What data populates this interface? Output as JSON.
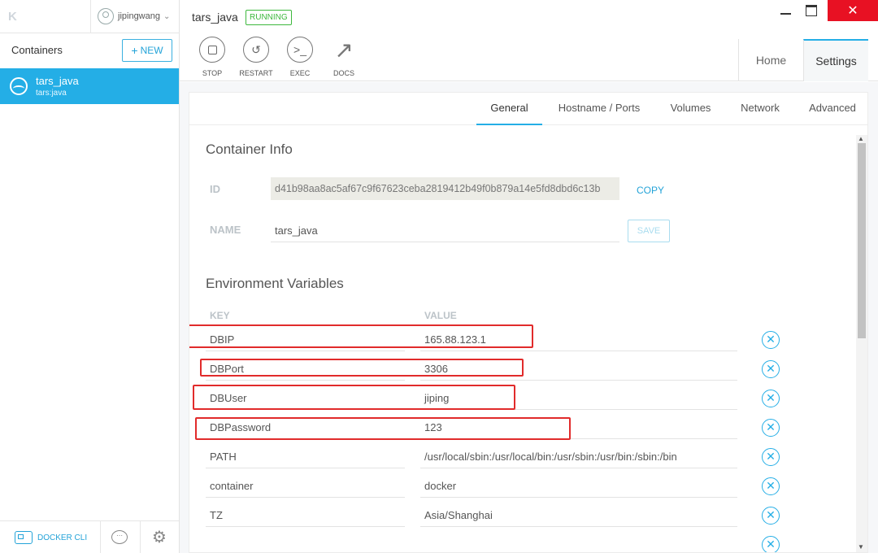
{
  "sidebar": {
    "logo": "K",
    "user": "jipingwang",
    "containers_title": "Containers",
    "new_button": "NEW",
    "items": [
      {
        "name": "tars_java",
        "image": "tars:java"
      }
    ],
    "footer": {
      "docker_cli": "DOCKER CLI"
    }
  },
  "header": {
    "title": "tars_java",
    "status": "RUNNING",
    "toolbar": [
      {
        "label": "STOP",
        "icon": "stop-icon"
      },
      {
        "label": "RESTART",
        "icon": "restart-icon"
      },
      {
        "label": "EXEC",
        "icon": "terminal-icon"
      },
      {
        "label": "DOCS",
        "icon": "external-link-icon"
      }
    ],
    "tabs": [
      "Home",
      "Settings"
    ],
    "active_tab": "Settings"
  },
  "settings": {
    "sub_tabs": [
      "General",
      "Hostname / Ports",
      "Volumes",
      "Network",
      "Advanced"
    ],
    "active_sub_tab": "General",
    "container_info": {
      "title": "Container Info",
      "id_label": "ID",
      "id_value": "d41b98aa8ac5af67c9f67623ceba2819412b49f0b879a14e5fd8dbd6c13b",
      "copy_label": "COPY",
      "name_label": "NAME",
      "name_value": "tars_java",
      "save_label": "SAVE"
    },
    "env": {
      "title": "Environment Variables",
      "key_header": "KEY",
      "value_header": "VALUE",
      "rows": [
        {
          "key": "DBIP",
          "value": "165.88.123.1"
        },
        {
          "key": "DBPort",
          "value": "3306"
        },
        {
          "key": "DBUser",
          "value": "jiping"
        },
        {
          "key": "DBPassword",
          "value": "123"
        },
        {
          "key": "PATH",
          "value": "/usr/local/sbin:/usr/local/bin:/usr/sbin:/usr/bin:/sbin:/bin"
        },
        {
          "key": "container",
          "value": "docker"
        },
        {
          "key": "TZ",
          "value": "Asia/Shanghai"
        }
      ]
    }
  },
  "colors": {
    "accent": "#24aee6",
    "running": "#3db83d",
    "highlight": "#e12b2b",
    "close": "#e81123"
  }
}
